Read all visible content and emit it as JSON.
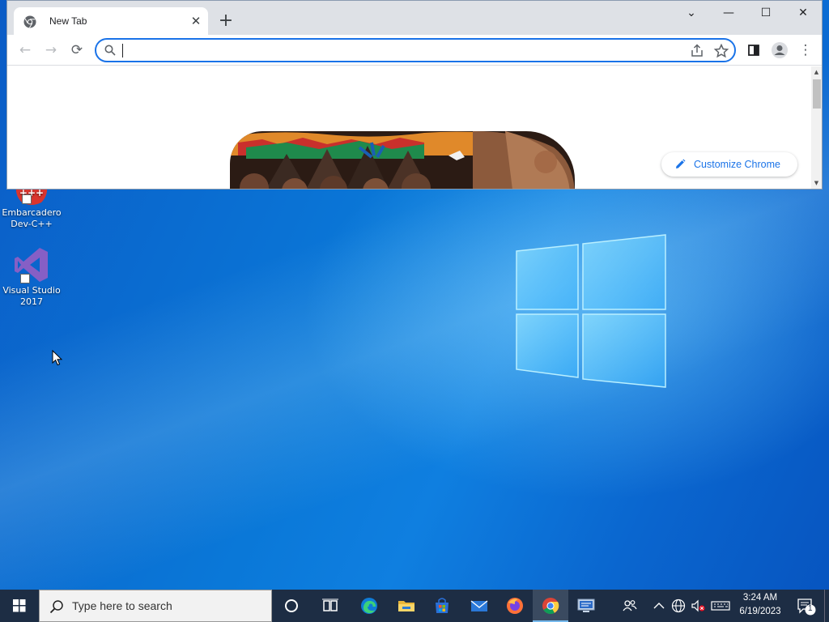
{
  "desktop": {
    "icons": [
      {
        "label": "Embarcadero Dev-C++",
        "icon": "devcpp-icon"
      },
      {
        "label": "Visual Studio 2017",
        "icon": "visual-studio-icon"
      }
    ]
  },
  "browser": {
    "tab": {
      "title": "New Tab",
      "favicon": "chrome-icon",
      "close": "✕"
    },
    "new_tab": "+",
    "window_controls": {
      "tab_search": "⌄",
      "minimize": "—",
      "maximize": "☐",
      "close": "✕"
    },
    "toolbar": {
      "back": "←",
      "forward": "→",
      "reload": "⟳",
      "omnibox_value": "",
      "menu": "⋮"
    },
    "page": {
      "customize_label": "Customize Chrome"
    },
    "scroll_position": 0.1
  },
  "taskbar": {
    "search_placeholder": "Type here to search",
    "apps": [
      "cortana-icon",
      "task-view-icon",
      "edge-icon",
      "file-explorer-icon",
      "store-icon",
      "mail-icon",
      "firefox-icon",
      "chrome-icon",
      "remote-desktop-icon"
    ],
    "active_app": "chrome-icon",
    "clock": {
      "time": "3:24 AM",
      "date": "6/19/2023"
    },
    "notification_count": "1"
  },
  "colors": {
    "accent": "#1a73e8",
    "taskbar": "#1d2d44",
    "wallpaper": "#0a72d1"
  }
}
